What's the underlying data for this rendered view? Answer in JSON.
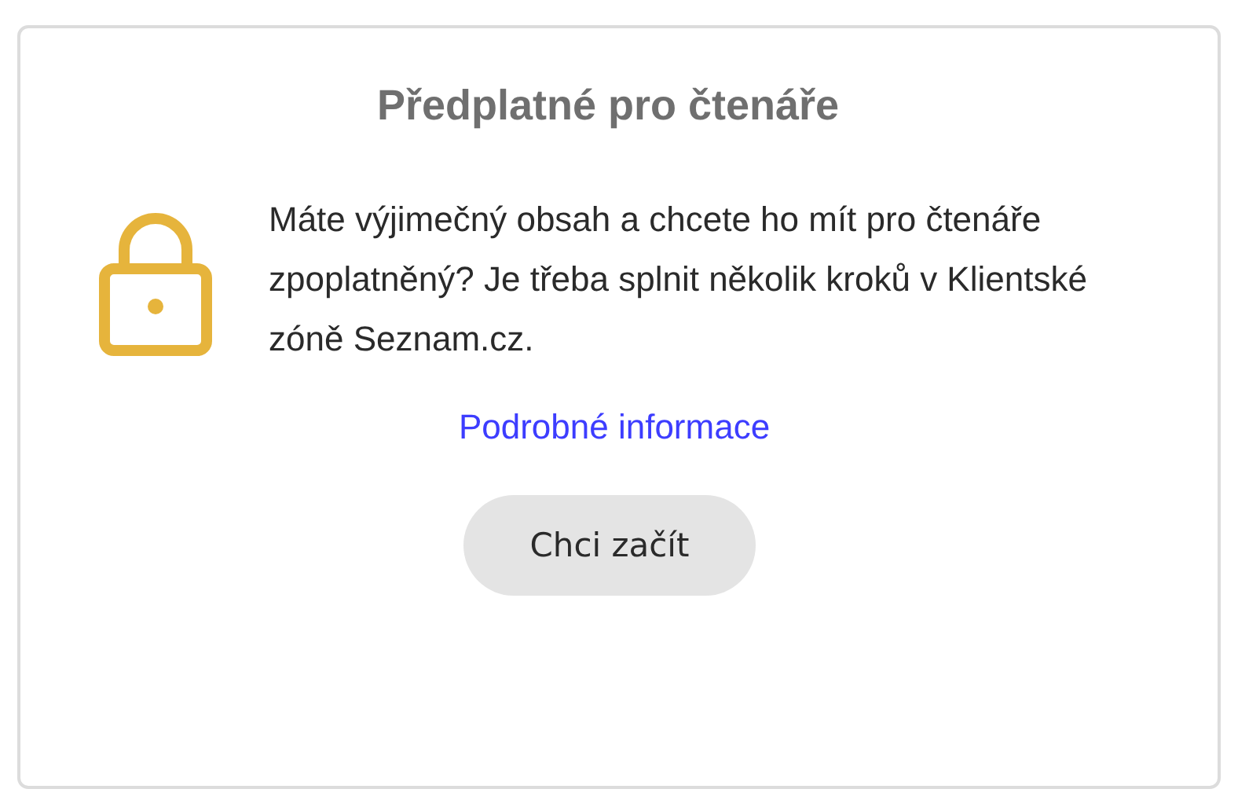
{
  "card": {
    "title": "Předplatné pro čtenáře",
    "description": "Máte výjimečný obsah a chcete ho mít pro čtenáře zpoplatněný? Je třeba splnit několik kroků v Klientské zóně Seznam.cz.",
    "link": "Podrobné informace",
    "button": "Chci začít"
  }
}
